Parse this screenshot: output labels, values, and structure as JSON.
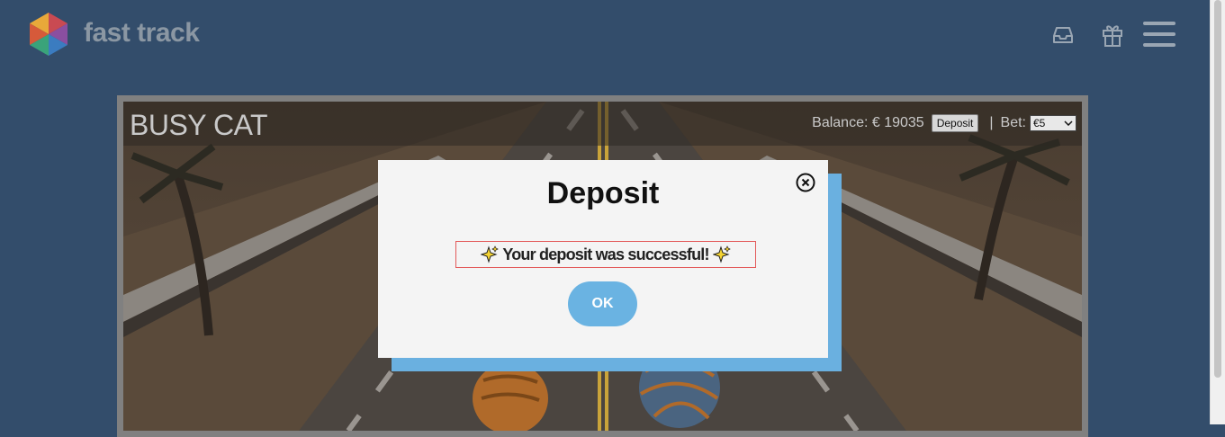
{
  "header": {
    "brand": "fast track",
    "icons": [
      "inbox-icon",
      "gift-icon",
      "menu-icon"
    ]
  },
  "game": {
    "title": "BUSY CAT",
    "balance_label": "Balance: € 19035",
    "deposit_label": "Deposit",
    "separator": "|",
    "bet_label": "Bet:",
    "bet_value": "€5"
  },
  "modal": {
    "title": "Deposit",
    "message": "Your deposit was successful!",
    "ok_label": "OK"
  },
  "colors": {
    "background": "#334d6b",
    "modal_accent": "#6ab0e0",
    "message_border": "#e35a5a"
  }
}
